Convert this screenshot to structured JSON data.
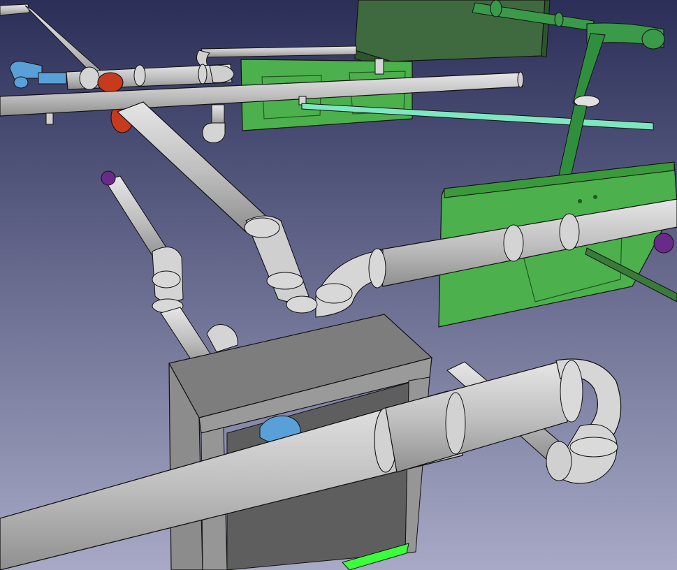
{
  "viewport": {
    "background_top": "#2b2f58",
    "background_bottom": "#a7a9c6"
  },
  "colors": {
    "pipe_gray": "#c4c4c4",
    "pipe_outline": "#1a1a1a",
    "fitting_red": "#c83a1e",
    "fitting_blue": "#5aa0d8",
    "fitting_purple": "#6a2a8a",
    "cabinet_dark_green": "#3f6a3f",
    "panel_green": "#4cb04c",
    "vent_green": "#2f8f3f",
    "mint_pipe": "#7fe6c2",
    "box_gray": "#8c8c8c",
    "base_highlight": "#3cff3c"
  }
}
